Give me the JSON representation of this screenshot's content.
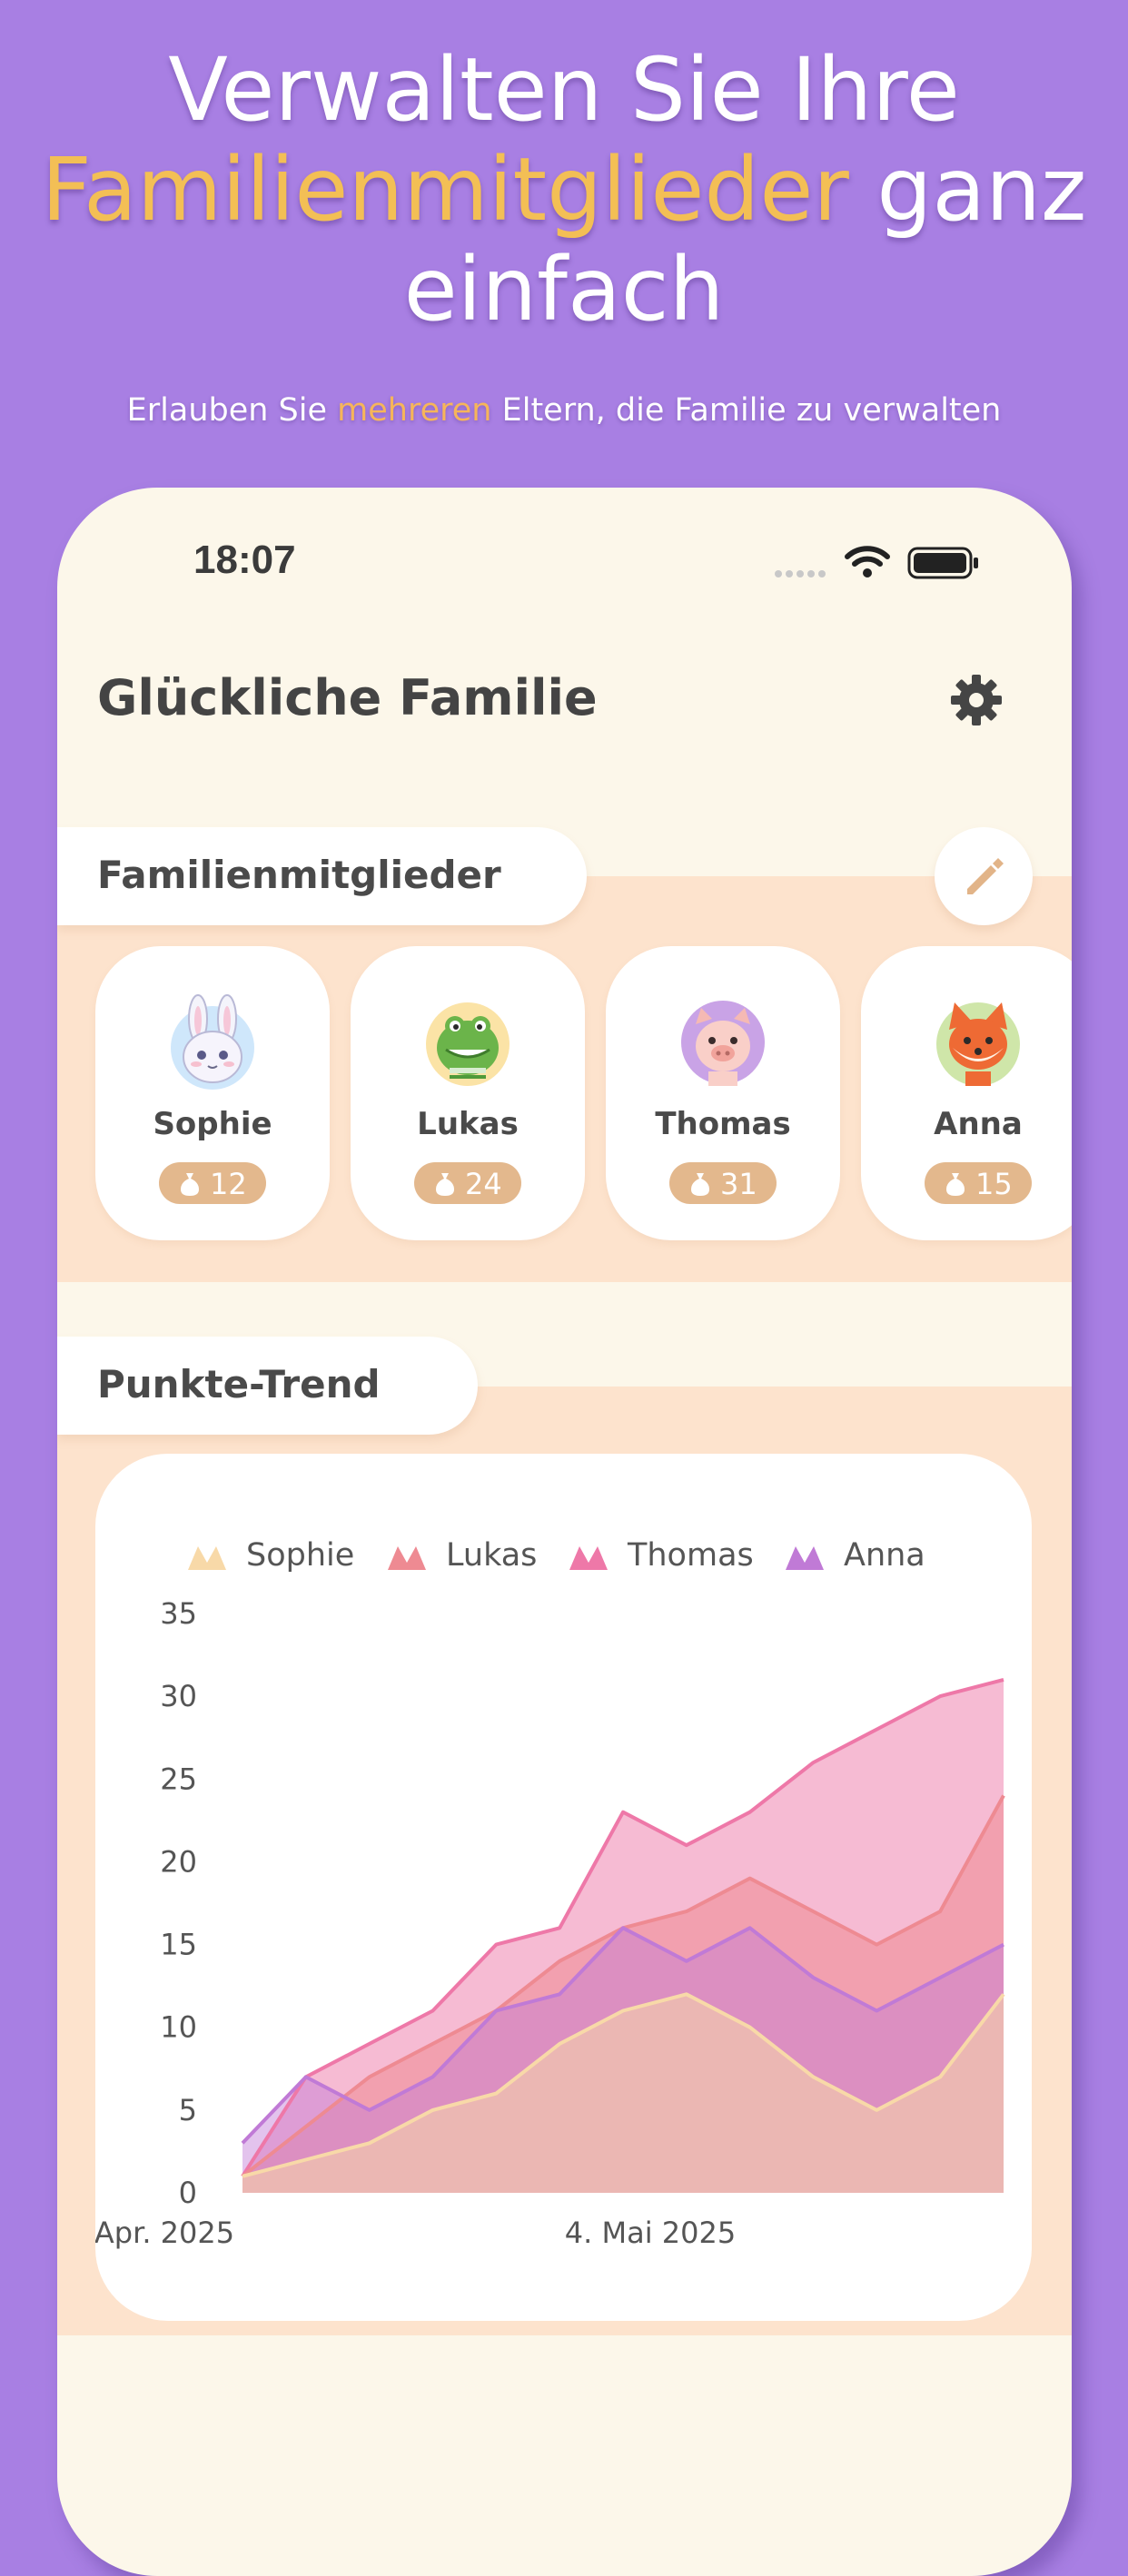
{
  "promo": {
    "headline_line1": "Verwalten Sie Ihre",
    "headline_highlight": "Familienmitglieder",
    "headline_line2_rest": " ganz",
    "headline_line3": "einfach",
    "subline_pre": "Erlauben Sie ",
    "subline_highlight": "mehreren",
    "subline_post": " Eltern, die Familie zu verwalten",
    "highlight_color": "#f3bf55"
  },
  "status_bar": {
    "time": "18:07"
  },
  "app": {
    "title": "Glückliche Familie",
    "settings_icon": "gear-icon"
  },
  "members_section": {
    "title": "Familienmitglieder",
    "edit_icon": "pencil-icon",
    "members": [
      {
        "name": "Sophie",
        "points": "12",
        "avatar": "bunny"
      },
      {
        "name": "Lukas",
        "points": "24",
        "avatar": "crocodile"
      },
      {
        "name": "Thomas",
        "points": "31",
        "avatar": "pig"
      },
      {
        "name": "Anna",
        "points": "15",
        "avatar": "fox"
      }
    ]
  },
  "trend_section": {
    "title": "Punkte-Trend"
  },
  "chart_data": {
    "type": "area",
    "title": "",
    "xlabel": "",
    "ylabel": "",
    "ylim": [
      0,
      35
    ],
    "yticks": [
      0,
      5,
      10,
      15,
      20,
      25,
      30,
      35
    ],
    "x_tick_labels": [
      "Apr. 2025",
      "4. Mai 2025"
    ],
    "legend_position": "top",
    "series": [
      {
        "name": "Sophie",
        "color": "#f8d9a8",
        "values": [
          1,
          2,
          3,
          5,
          6,
          9,
          11,
          12,
          10,
          7,
          5,
          7,
          12
        ]
      },
      {
        "name": "Lukas",
        "color": "#ee8a92",
        "values": [
          1,
          4,
          7,
          9,
          11,
          14,
          16,
          17,
          19,
          17,
          15,
          17,
          24
        ]
      },
      {
        "name": "Thomas",
        "color": "#ee78a8",
        "values": [
          1,
          7,
          9,
          11,
          15,
          16,
          23,
          21,
          23,
          26,
          28,
          30,
          31
        ]
      },
      {
        "name": "Anna",
        "color": "#c07ad6",
        "values": [
          3,
          7,
          5,
          7,
          11,
          12,
          16,
          14,
          16,
          13,
          11,
          13,
          15
        ]
      }
    ]
  }
}
